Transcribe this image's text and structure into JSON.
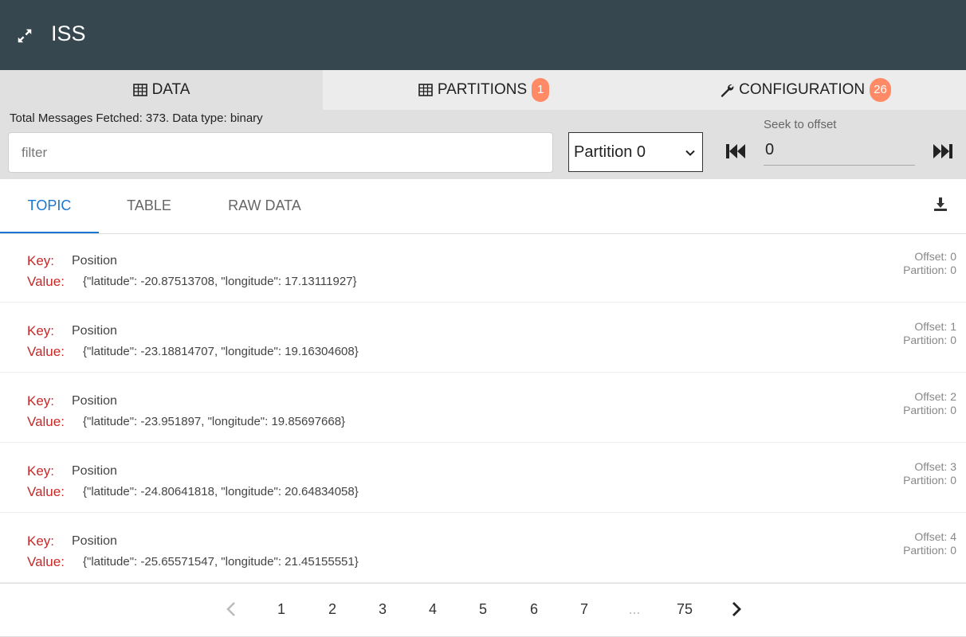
{
  "app": {
    "title": "ISS"
  },
  "top_tabs": [
    {
      "label": "DATA",
      "icon": "table-icon"
    },
    {
      "label": "PARTITIONS",
      "icon": "table-icon",
      "badge": "1"
    },
    {
      "label": "CONFIGURATION",
      "icon": "wrench-icon",
      "badge": "26"
    }
  ],
  "filter_bar": {
    "total_text": "Total Messages Fetched: 373. Data type: binary",
    "filter_placeholder": "filter",
    "partition_selected": "Partition 0",
    "seek_label": "Seek to offset",
    "seek_value": "0"
  },
  "sub_tabs": [
    "TOPIC",
    "TABLE",
    "RAW DATA"
  ],
  "labels": {
    "key": "Key:",
    "value": "Value:"
  },
  "messages": [
    {
      "key": "Position",
      "value": "{\"latitude\": -20.87513708, \"longitude\": 17.13111927}",
      "offset": "Offset: 0",
      "partition": "Partition: 0"
    },
    {
      "key": "Position",
      "value": "{\"latitude\": -23.18814707, \"longitude\": 19.16304608}",
      "offset": "Offset: 1",
      "partition": "Partition: 0"
    },
    {
      "key": "Position",
      "value": "{\"latitude\": -23.951897, \"longitude\": 19.85697668}",
      "offset": "Offset: 2",
      "partition": "Partition: 0"
    },
    {
      "key": "Position",
      "value": "{\"latitude\": -24.80641818, \"longitude\": 20.64834058}",
      "offset": "Offset: 3",
      "partition": "Partition: 0"
    },
    {
      "key": "Position",
      "value": "{\"latitude\": -25.65571547, \"longitude\": 21.45155551}",
      "offset": "Offset: 4",
      "partition": "Partition: 0"
    }
  ],
  "pagination": {
    "pages": [
      "1",
      "2",
      "3",
      "4",
      "5",
      "6",
      "7"
    ],
    "ellipsis": "...",
    "last_page": "75"
  },
  "colors": {
    "appbar": "#37474f",
    "accent": "#1976d2",
    "badge": "#ff8a65",
    "key_label": "#c62828"
  }
}
